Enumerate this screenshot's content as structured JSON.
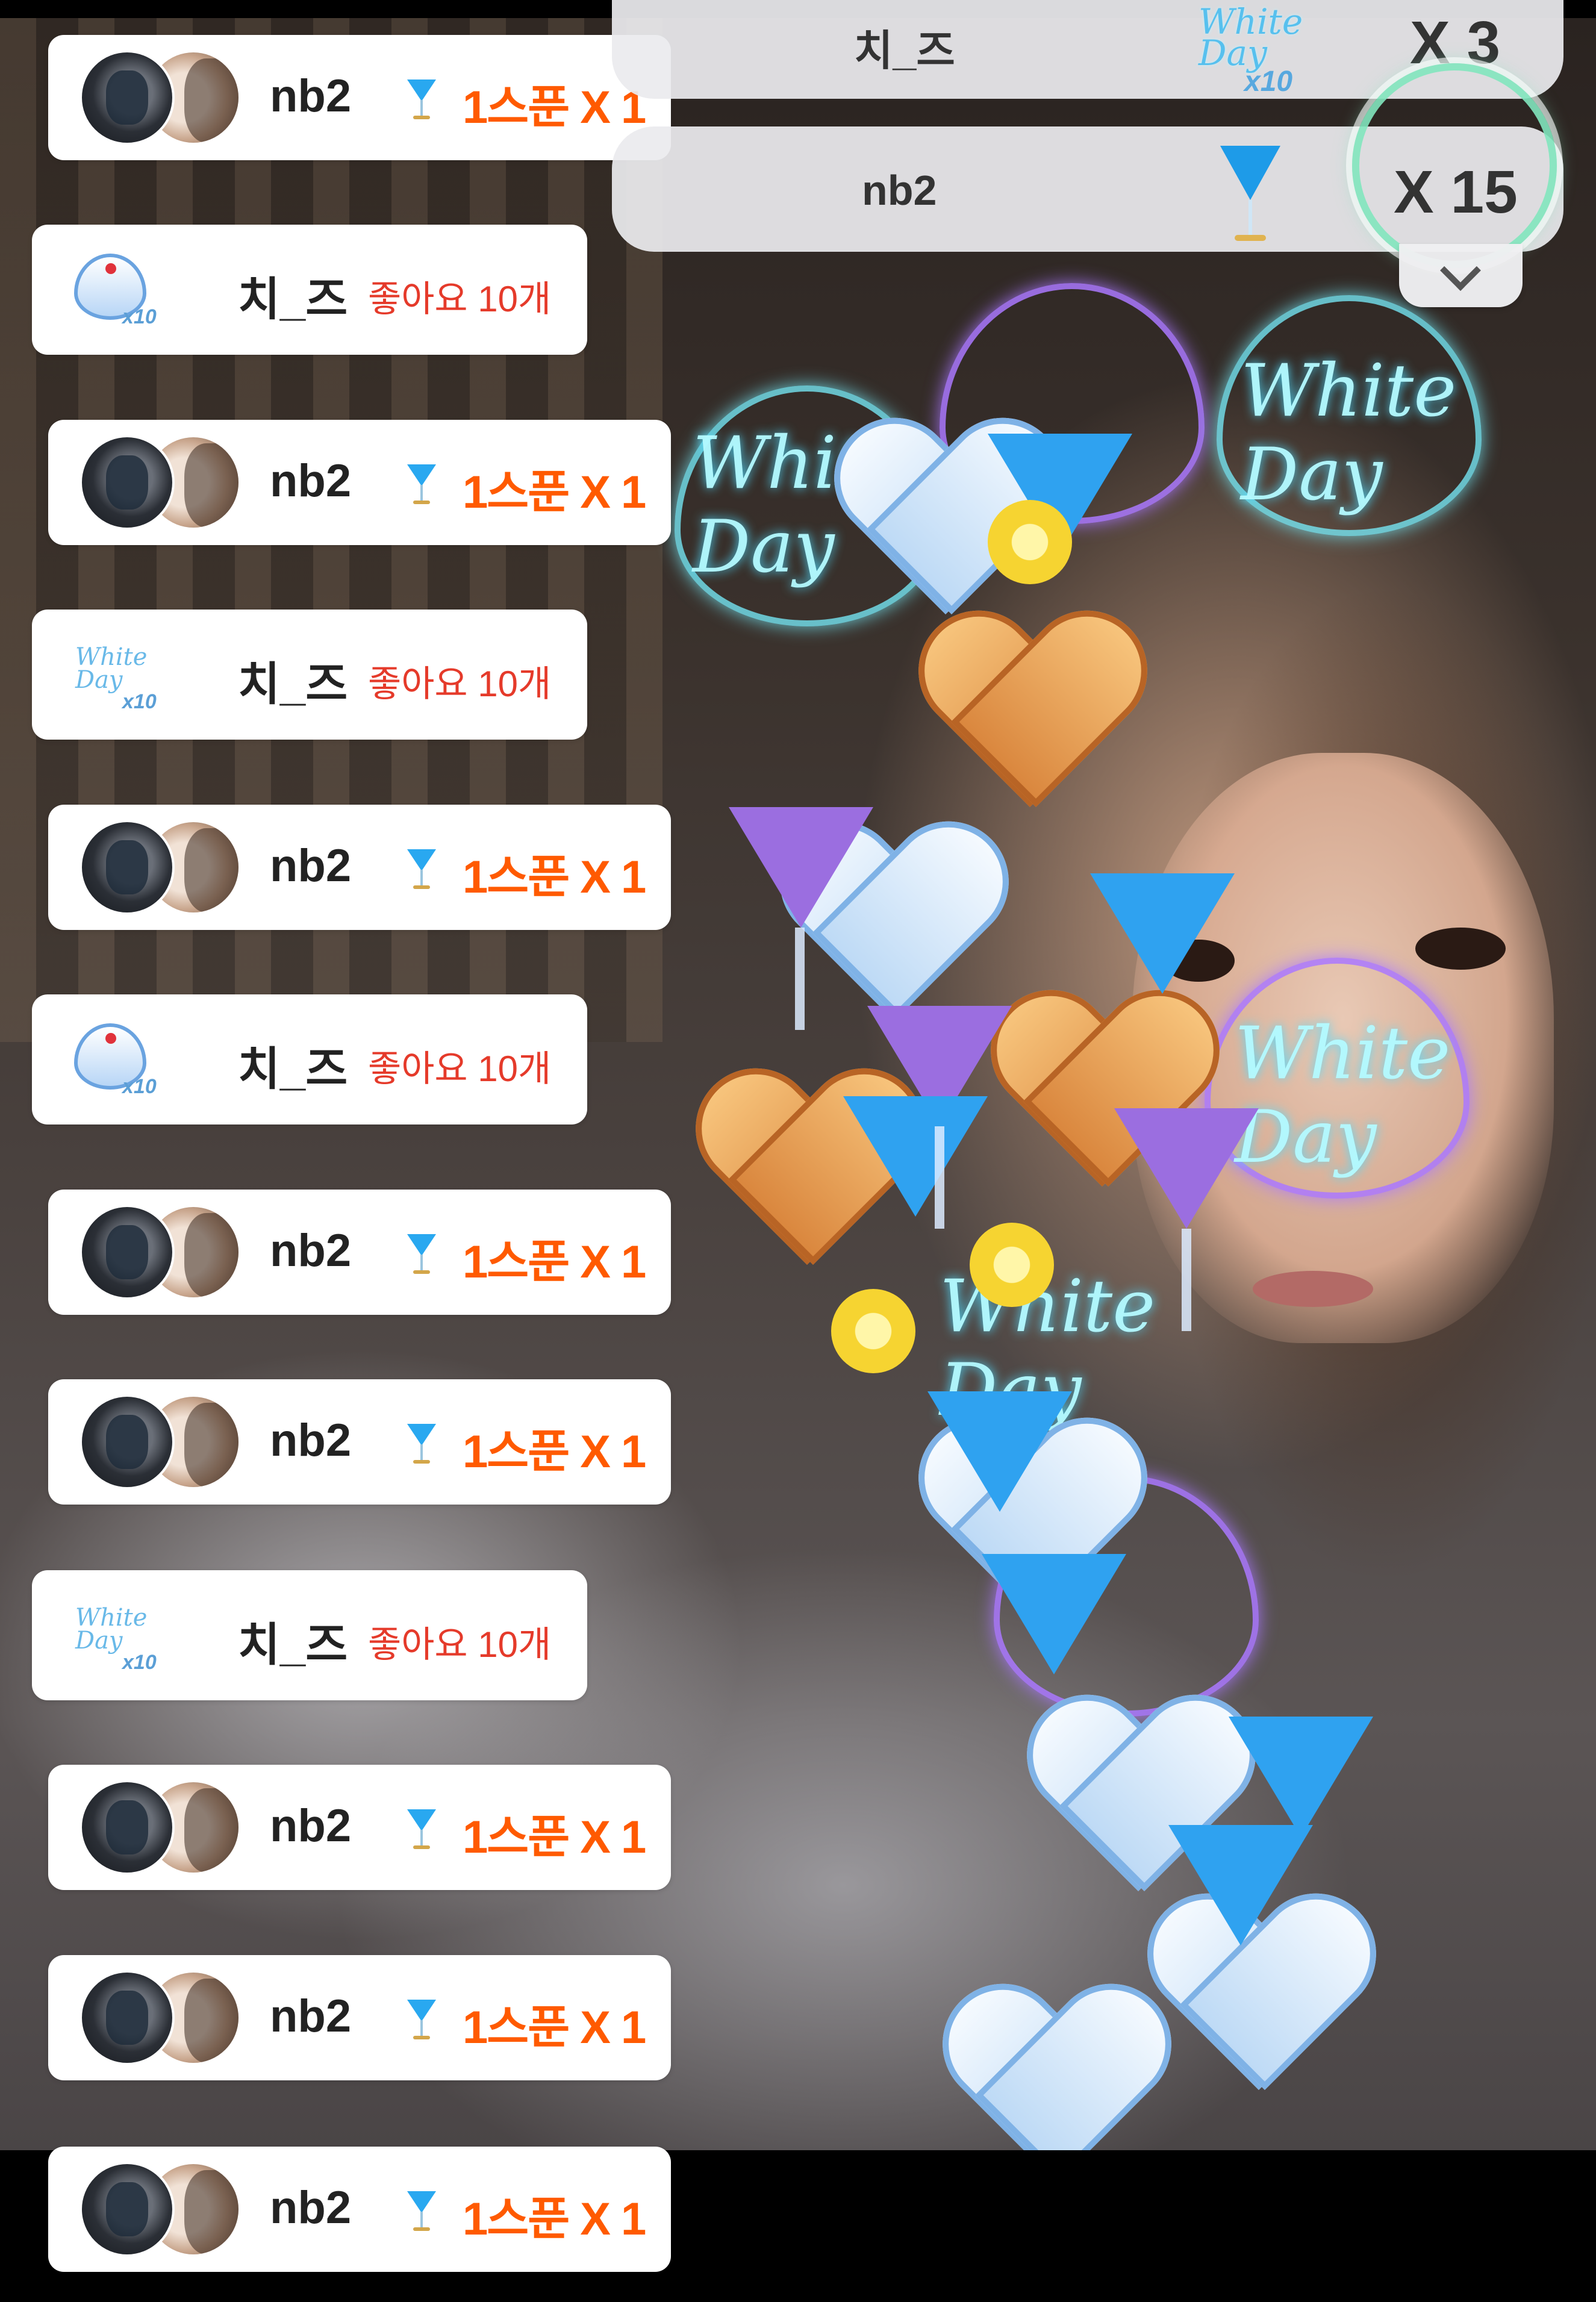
{
  "chat": {
    "items": [
      {
        "type": "spoon",
        "nickname": "nb2",
        "gift_text": "1스푼 X 1"
      },
      {
        "type": "like",
        "nickname": "치_즈",
        "like_text": "좋아요 10개",
        "gift_icon": "white-day-cookie"
      },
      {
        "type": "spoon",
        "nickname": "nb2",
        "gift_text": "1스푼 X 1"
      },
      {
        "type": "like",
        "nickname": "치_즈",
        "like_text": "좋아요 10개",
        "gift_icon": "white-day-neon"
      },
      {
        "type": "spoon",
        "nickname": "nb2",
        "gift_text": "1스푼 X 1"
      },
      {
        "type": "like",
        "nickname": "치_즈",
        "like_text": "좋아요 10개",
        "gift_icon": "white-day-cookie"
      },
      {
        "type": "spoon",
        "nickname": "nb2",
        "gift_text": "1스푼 X 1"
      },
      {
        "type": "spoon",
        "nickname": "nb2",
        "gift_text": "1스푼 X 1"
      },
      {
        "type": "like",
        "nickname": "치_즈",
        "like_text": "좋아요 10개",
        "gift_icon": "white-day-neon"
      },
      {
        "type": "spoon",
        "nickname": "nb2",
        "gift_text": "1스푼 X 1"
      },
      {
        "type": "spoon",
        "nickname": "nb2",
        "gift_text": "1스푼 X 1"
      },
      {
        "type": "spoon",
        "nickname": "nb2",
        "gift_text": "1스푼 X 1"
      }
    ],
    "like_icon_word": "White Day",
    "like_icon_multiplier": "x10"
  },
  "ranking": {
    "rows": [
      {
        "nickname": "치_즈",
        "count": "X 3",
        "gift_icon": "white-day-x10",
        "gift_word": "White Day",
        "gift_multiplier": "x10"
      },
      {
        "nickname": "nb2",
        "count": "X 15",
        "gift_icon": "blue-cocktail"
      }
    ],
    "expand_icon": "chevron-down-icon"
  },
  "overlay": {
    "neon_text": [
      "White Day",
      "White Day",
      "White Day",
      "White Day"
    ]
  },
  "colors": {
    "spoon_accent": "#ff5a00",
    "like_accent": "#e53a2a",
    "nickname": "#222222",
    "card_bg": "#ffffff",
    "panel_bg": "#ebebee",
    "ring": "#82e6be"
  }
}
